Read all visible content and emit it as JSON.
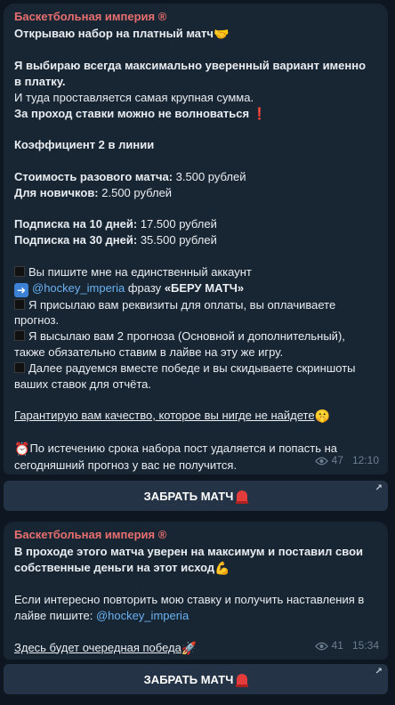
{
  "post1": {
    "author": "Баскетбольная империя ®",
    "l1": "Открываю набор на платный матч",
    "l3a": "Я выбираю всегда максимально уверенный вариант именно",
    "l3b": "в платку.",
    "l4": "И туда проставляется самая крупная сумма.",
    "l5": "За проход ставки можно не волноваться",
    "coef": "Коэффициент 2 в линии",
    "price_label": "Стоимость разового матча:",
    "price_value": " 3.500 рублей",
    "new_label": "Для новичков:",
    "new_value": " 2.500 рублей",
    "sub10_label": "Подписка на 10 дней:",
    "sub10_value": " 17.500 рублей",
    "sub30_label": "Подписка на 30 дней:",
    "sub30_value": " 35.500 рублей",
    "step1": "Вы пишите мне на единственный аккаунт",
    "step2_link": "@hockey_imperia",
    "step2_text": " фразу ",
    "step2_bold": "«БЕРУ МАТЧ»",
    "step3a": "Я присылаю вам реквизиты для оплаты, вы оплачиваете",
    "step3b": "прогноз.",
    "step4a": "Я высылаю вам 2 прогноза (Основной и дополнительный),",
    "step4b": "также обязательно ставим в лайве на эту же игру.",
    "step5a": "Далее радуемся вместе победе и вы скидываете скриншоты",
    "step5b": "ваших ставок для отчёта.",
    "guarantee": "Гарантирую вам качество, которое вы нигде не найдете",
    "notice_a": "По истечению срока набора пост удаляется и попасть на",
    "notice_b": "сегодняшний прогноз у вас не получится.",
    "views": "47",
    "time": "12:10",
    "button": "ЗАБРАТЬ МАТЧ"
  },
  "post2": {
    "author": "Баскетбольная империя ®",
    "l1": "В проходе этого матча уверен на максимум и поставил свои",
    "l2": "собственные деньги на этот исход",
    "l3a": "Если интересно повторить мою ставку и получить наставления в",
    "l3b_text": "лайве пишите: ",
    "l3b_link": "@hockey_imperia",
    "l4": "Здесь будет очередная победа",
    "views": "41",
    "time": "15:34",
    "button": "ЗАБРАТЬ МАТЧ"
  },
  "icons": {
    "handshake": "handshake-icon",
    "exclamation": "red-exclamation-icon",
    "square": "black-square-icon",
    "arrow": "right-arrow-icon",
    "thinking": "thinking-face-icon",
    "alarm": "alarm-clock-icon",
    "muscle": "flexed-biceps-icon",
    "rocket": "rocket-icon",
    "siren": "siren-icon",
    "eye": "eye-icon"
  },
  "colors": {
    "background": "#0e1621",
    "bubble": "#182533",
    "author": "#e86f6f",
    "link": "#6ab2f2",
    "button": "#243446"
  }
}
